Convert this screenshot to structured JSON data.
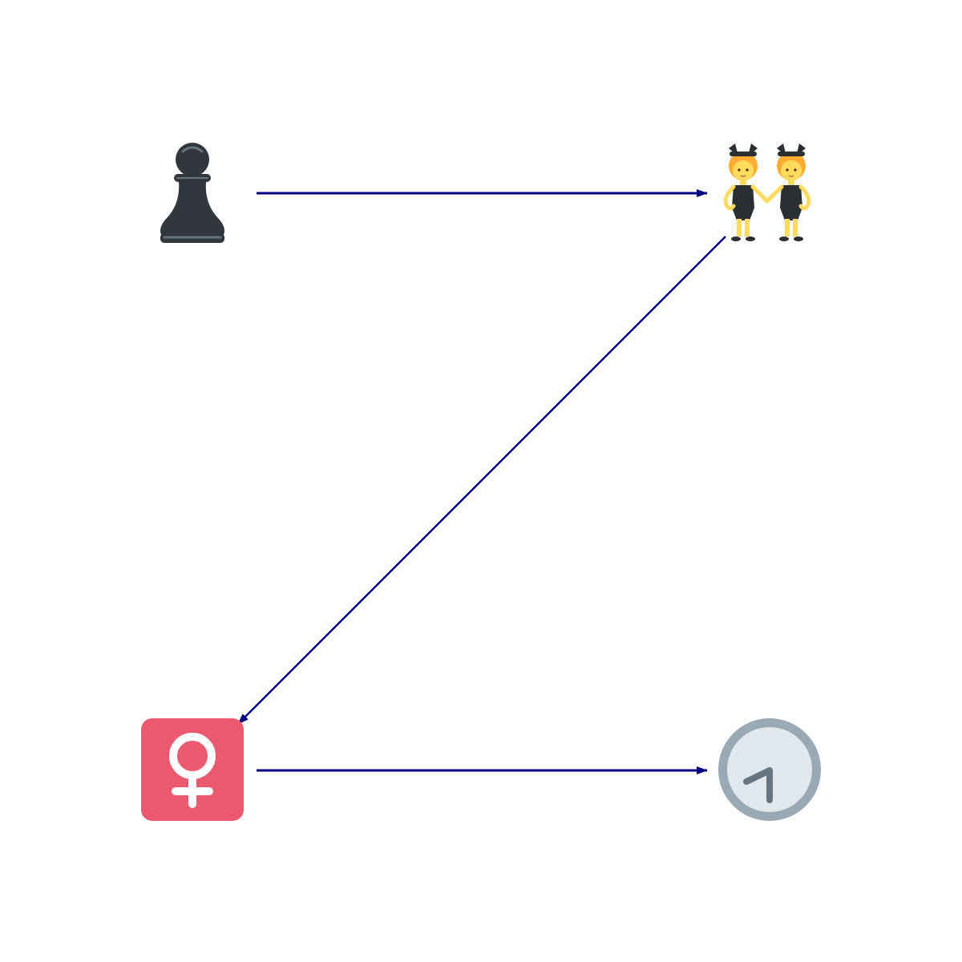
{
  "diagram": {
    "edge_color": "#000080",
    "nodes": [
      {
        "id": "pawn",
        "icon": "black-chess-pawn-icon",
        "emoji": "♟"
      },
      {
        "id": "dancers",
        "icon": "people-with-bunny-ears-icon",
        "emoji": "👯"
      },
      {
        "id": "female",
        "icon": "female-sign-icon",
        "emoji": "♀"
      },
      {
        "id": "clock",
        "icon": "clock-seven-oclock-icon",
        "emoji": "🕖"
      }
    ],
    "edges": [
      {
        "from": "pawn",
        "to": "dancers"
      },
      {
        "from": "dancers",
        "to": "female"
      },
      {
        "from": "female",
        "to": "clock"
      }
    ],
    "colors": {
      "pawn": "#31373d",
      "female_bg": "#ea596e",
      "clock_rim": "#99aab5",
      "clock_face": "#e1e8ed",
      "clock_hands": "#66757f",
      "dancer_skin": "#ffdc5d",
      "dancer_hair": "#ffac33",
      "dancer_outfit": "#292f33"
    }
  }
}
